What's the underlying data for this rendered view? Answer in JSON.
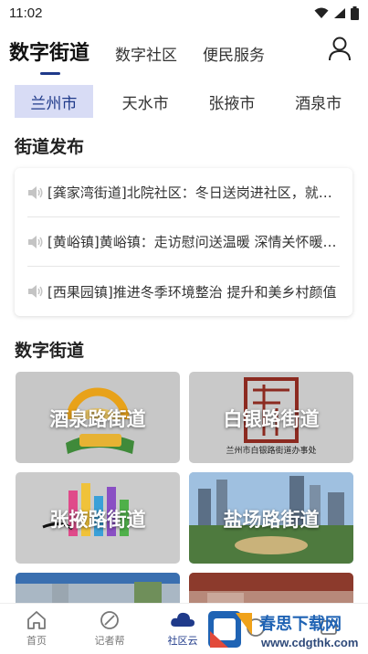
{
  "status_bar": {
    "time": "11:02"
  },
  "top_tabs": [
    {
      "label": "数字街道",
      "active": true
    },
    {
      "label": "数字社区",
      "active": false
    },
    {
      "label": "便民服务",
      "active": false
    }
  ],
  "city_tabs": [
    {
      "label": "兰州市",
      "active": true
    },
    {
      "label": "天水市",
      "active": false
    },
    {
      "label": "张掖市",
      "active": false
    },
    {
      "label": "酒泉市",
      "active": false
    }
  ],
  "news_section": {
    "title": "街道发布",
    "items": [
      "[龚家湾街道]北院社区：冬日送岗进社区，就业服务暖人心",
      "[黄峪镇]黄峪镇：走访慰问送温暖 深情关怀暖人心",
      "[西果园镇]推进冬季环境整治 提升和美乡村颜值"
    ]
  },
  "digital_section": {
    "title": "数字街道",
    "tiles": [
      {
        "label": "酒泉路街道",
        "sub": ""
      },
      {
        "label": "白银路街道",
        "sub": "兰州市白银路街道办事处"
      },
      {
        "label": "张掖路街道",
        "sub": ""
      },
      {
        "label": "盐场路街道",
        "sub": ""
      }
    ]
  },
  "bottom_nav": [
    {
      "label": "首页",
      "icon": "home-icon",
      "active": false
    },
    {
      "label": "记者帮",
      "icon": "reporter-icon",
      "active": false
    },
    {
      "label": "社区云",
      "icon": "cloud-icon",
      "active": true
    },
    {
      "label": "",
      "icon": "profile-icon",
      "active": false
    },
    {
      "label": "",
      "icon": "more-icon",
      "active": false
    }
  ],
  "watermark": {
    "title": "春思下载网",
    "url": "www.cdgthk.com"
  },
  "colors": {
    "accent": "#1f3a8a",
    "city_tab_active_bg": "#d8dcf5"
  }
}
